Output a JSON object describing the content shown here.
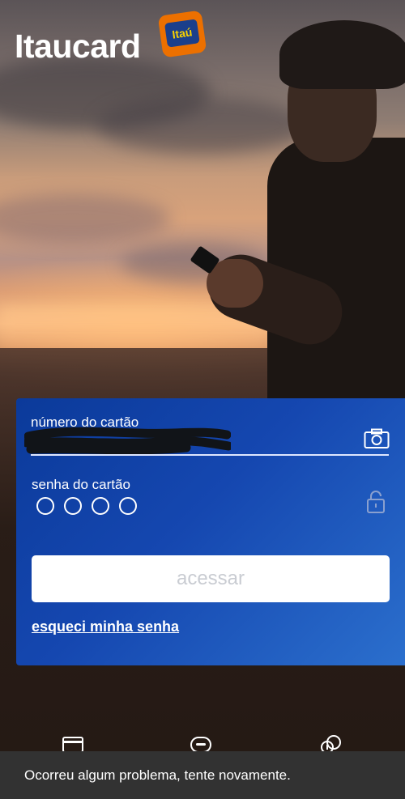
{
  "brand": {
    "name": "Itaucard",
    "badge_text": "Itaú",
    "colors": {
      "orange": "#ec7000",
      "navy": "#1b3f8b",
      "yellow": "#f7d000"
    }
  },
  "login": {
    "card_number_label": "número do cartão",
    "card_number_value": "",
    "password_label": "senha do cartão",
    "password_digits": 4,
    "access_button_label": "acessar",
    "forgot_password_link": "esqueci minha senha",
    "colors": {
      "card_gradient_start": "#0b3a9a",
      "card_gradient_end": "#2b6fcd",
      "button_text": "#c9ccd2"
    }
  },
  "icons": {
    "camera": "camera-icon",
    "lock": "lock-icon",
    "nav": [
      "card-icon",
      "chat-icon",
      "info-chat-icon"
    ]
  },
  "toast": {
    "message": "Ocorreu algum problema, tente novamente."
  }
}
